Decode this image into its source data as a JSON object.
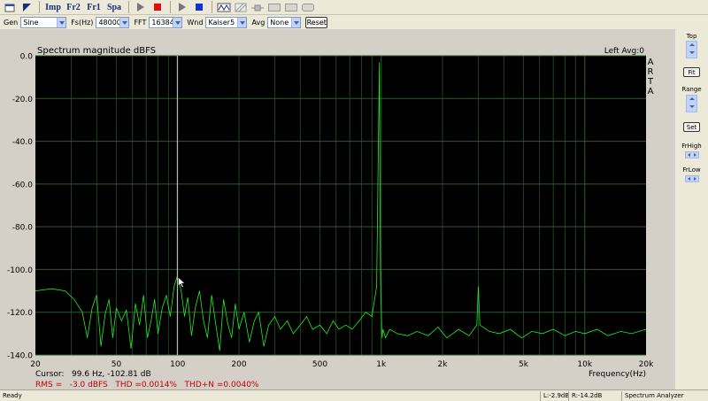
{
  "toolbar1": {
    "buttons": [
      {
        "name": "open-icon",
        "glyph": ""
      },
      {
        "name": "arrow-icon",
        "glyph": ""
      },
      {
        "name": "imp-button",
        "glyph": "Imp"
      },
      {
        "name": "fr2-button",
        "glyph": "Fr2"
      },
      {
        "name": "fr1-button",
        "glyph": "Fr1"
      },
      {
        "name": "spa-button",
        "glyph": "Spa"
      }
    ]
  },
  "toolbar2": {
    "gen_label": "Gen",
    "gen_value": "Sine",
    "fs_label": "Fs(Hz)",
    "fs_value": "48000",
    "fft_label": "FFT",
    "fft_value": "16384",
    "wnd_label": "Wnd",
    "wnd_value": "Kaiser5",
    "avg_label": "Avg",
    "avg_value": "None",
    "reset_label": "Reset"
  },
  "plot": {
    "title": "Spectrum magnitude dBFS",
    "channel_info": "Left  Avg:0",
    "brand_letters": [
      "A",
      "R",
      "T",
      "A"
    ],
    "cursor_text": "Cursor:   99.6 Hz, -102.81 dB",
    "rms_text": "RMS =   -3.0 dBFS   THD =0.0014%   THD+N =0.0040%",
    "xlabel": "Frequency(Hz)",
    "background": "#000000",
    "grid_color": "#2d5a2d",
    "trace_color": "#22ee22",
    "cursor_color": "#c8c8c8",
    "readout_color": "#c00000"
  },
  "chart_data": {
    "type": "line",
    "title": "Spectrum magnitude dBFS",
    "xlabel": "Frequency(Hz)",
    "ylabel": "",
    "xscale": "log",
    "xlim": [
      20,
      20000
    ],
    "ylim": [
      -140,
      0
    ],
    "x_ticks": [
      {
        "v": 20,
        "label": "20"
      },
      {
        "v": 50,
        "label": "50"
      },
      {
        "v": 100,
        "label": "100"
      },
      {
        "v": 200,
        "label": "200"
      },
      {
        "v": 500,
        "label": "500"
      },
      {
        "v": 1000,
        "label": "1k"
      },
      {
        "v": 2000,
        "label": "2k"
      },
      {
        "v": 5000,
        "label": "5k"
      },
      {
        "v": 10000,
        "label": "10k"
      },
      {
        "v": 20000,
        "label": "20k"
      }
    ],
    "y_ticks": [
      {
        "v": 0,
        "label": "0.0"
      },
      {
        "v": -20,
        "label": "-20.0"
      },
      {
        "v": -40,
        "label": "-40.0"
      },
      {
        "v": -60,
        "label": "-60.0"
      },
      {
        "v": -80,
        "label": "-80.0"
      },
      {
        "v": -100,
        "label": "-100.0"
      },
      {
        "v": -120,
        "label": "-120.0"
      },
      {
        "v": -140,
        "label": "-140.0"
      }
    ],
    "grid": true,
    "cursor": {
      "x": 99.6,
      "y": -102.81
    },
    "series": [
      {
        "x": [
          20,
          24,
          28,
          31,
          34,
          36,
          38,
          40,
          42,
          44,
          46,
          48,
          50,
          53,
          56,
          59,
          62,
          65,
          68,
          71,
          74,
          77,
          80,
          84,
          88,
          92,
          96,
          99.6,
          104,
          108,
          112,
          117,
          122,
          128,
          134,
          140,
          147,
          154,
          161,
          168,
          176,
          184,
          192,
          200,
          212,
          225,
          238,
          250,
          265,
          280,
          300,
          320,
          345,
          370,
          400,
          430,
          460,
          500,
          540,
          580,
          620,
          670,
          720,
          780,
          840,
          900,
          950,
          980,
          990,
          995,
          1000,
          1005,
          1010,
          1020,
          1050,
          1100,
          1200,
          1350,
          1500,
          1700,
          1900,
          2100,
          2400,
          2700,
          2950,
          3000,
          3050,
          3400,
          3800,
          4300,
          4900,
          5500,
          6200,
          7000,
          8000,
          9000,
          10000,
          11500,
          13000,
          15000,
          17000,
          20000
        ],
        "y": [
          -110,
          -109,
          -110,
          -114,
          -120,
          -132,
          -118,
          -112,
          -136,
          -121,
          -114,
          -132,
          -118,
          -124,
          -119,
          -137,
          -116,
          -126,
          -112,
          -132,
          -124,
          -114,
          -130,
          -118,
          -112,
          -122,
          -108,
          -103,
          -110,
          -122,
          -113,
          -131,
          -118,
          -110,
          -124,
          -132,
          -112,
          -126,
          -138,
          -114,
          -125,
          -132,
          -116,
          -128,
          -120,
          -134,
          -124,
          -120,
          -136,
          -126,
          -122,
          -128,
          -124,
          -130,
          -126,
          -122,
          -128,
          -126,
          -130,
          -124,
          -128,
          -126,
          -128,
          -124,
          -120,
          -122,
          -108,
          -3,
          -96,
          -112,
          -118,
          -128,
          -132,
          -128,
          -132,
          -128,
          -130,
          -131,
          -129,
          -131,
          -127,
          -132,
          -128,
          -131,
          -126,
          -108,
          -126,
          -129,
          -130,
          -128,
          -132,
          -129,
          -130,
          -128,
          -131,
          -129,
          -130,
          -128,
          -131,
          -129,
          -130,
          -128
        ]
      }
    ]
  },
  "right_panel": {
    "top_label": "Top",
    "fit_label": "Fit",
    "range_label": "Range",
    "set_label": "Set",
    "frhigh_label": "FrHigh",
    "frlow_label": "FrLow"
  },
  "status": {
    "ready": "Ready",
    "left_level": "L:-2.9dB",
    "right_level": "R:-14.2dB",
    "mode": "Spectrum Analyzer"
  }
}
